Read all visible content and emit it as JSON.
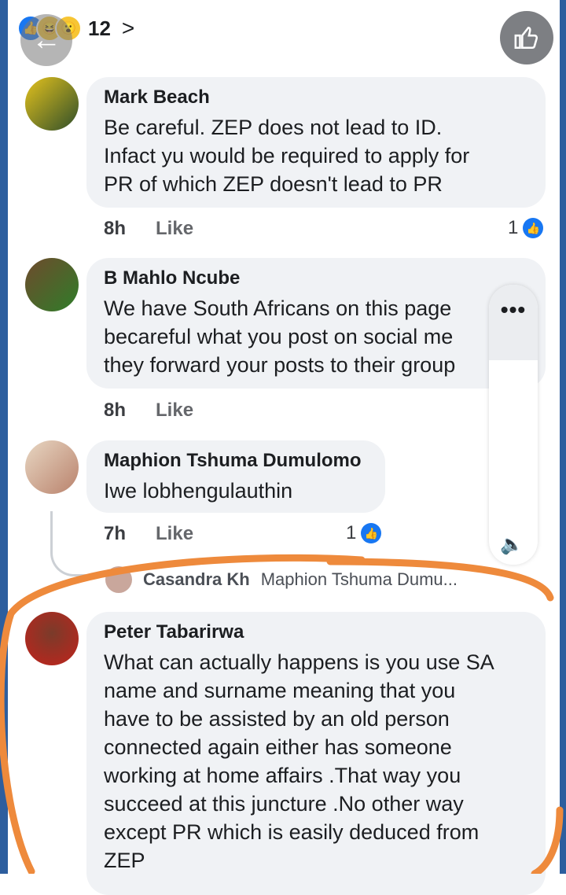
{
  "header": {
    "reaction_icons": [
      "like-icon",
      "haha-icon",
      "wow-icon"
    ],
    "reaction_count": "12",
    "chevron": ">"
  },
  "comments": [
    {
      "author": "Mark Beach",
      "text": "Be careful. ZEP does not lead to ID.\nInfact yu would be required to apply for\nPR of which ZEP doesn't lead to PR",
      "time": "8h",
      "like_label": "Like",
      "like_count": "1"
    },
    {
      "author": "B Mahlo Ncube",
      "text": "We have South Africans on this page\nbecareful what you post on social me\nthey forward your posts to their group",
      "time": "8h",
      "like_label": "Like"
    },
    {
      "author": "Maphion Tshuma Dumulomo",
      "text": "Iwe lobhengulauthin",
      "time": "7h",
      "like_label": "Like",
      "like_count": "1"
    },
    {
      "author": "Peter Tabarirwa",
      "text": "What can actually happens is you use SA\nname and surname meaning that you\nhave to be assisted by an old person\nconnected again either has someone\nworking at home affairs .That way you\nsucceed at this juncture .No other way\nexcept PR which is easily deduced from\nZEP"
    }
  ],
  "reply_preview": {
    "author": "Casandra Kh",
    "text": "Maphion Tshuma Dumu..."
  },
  "popup": {
    "more_label": "•••",
    "volume_icon": "speaker-icon"
  },
  "colors": {
    "accent": "#1877f2",
    "bubble": "#f0f2f5",
    "annotation": "#ee8a3c"
  }
}
